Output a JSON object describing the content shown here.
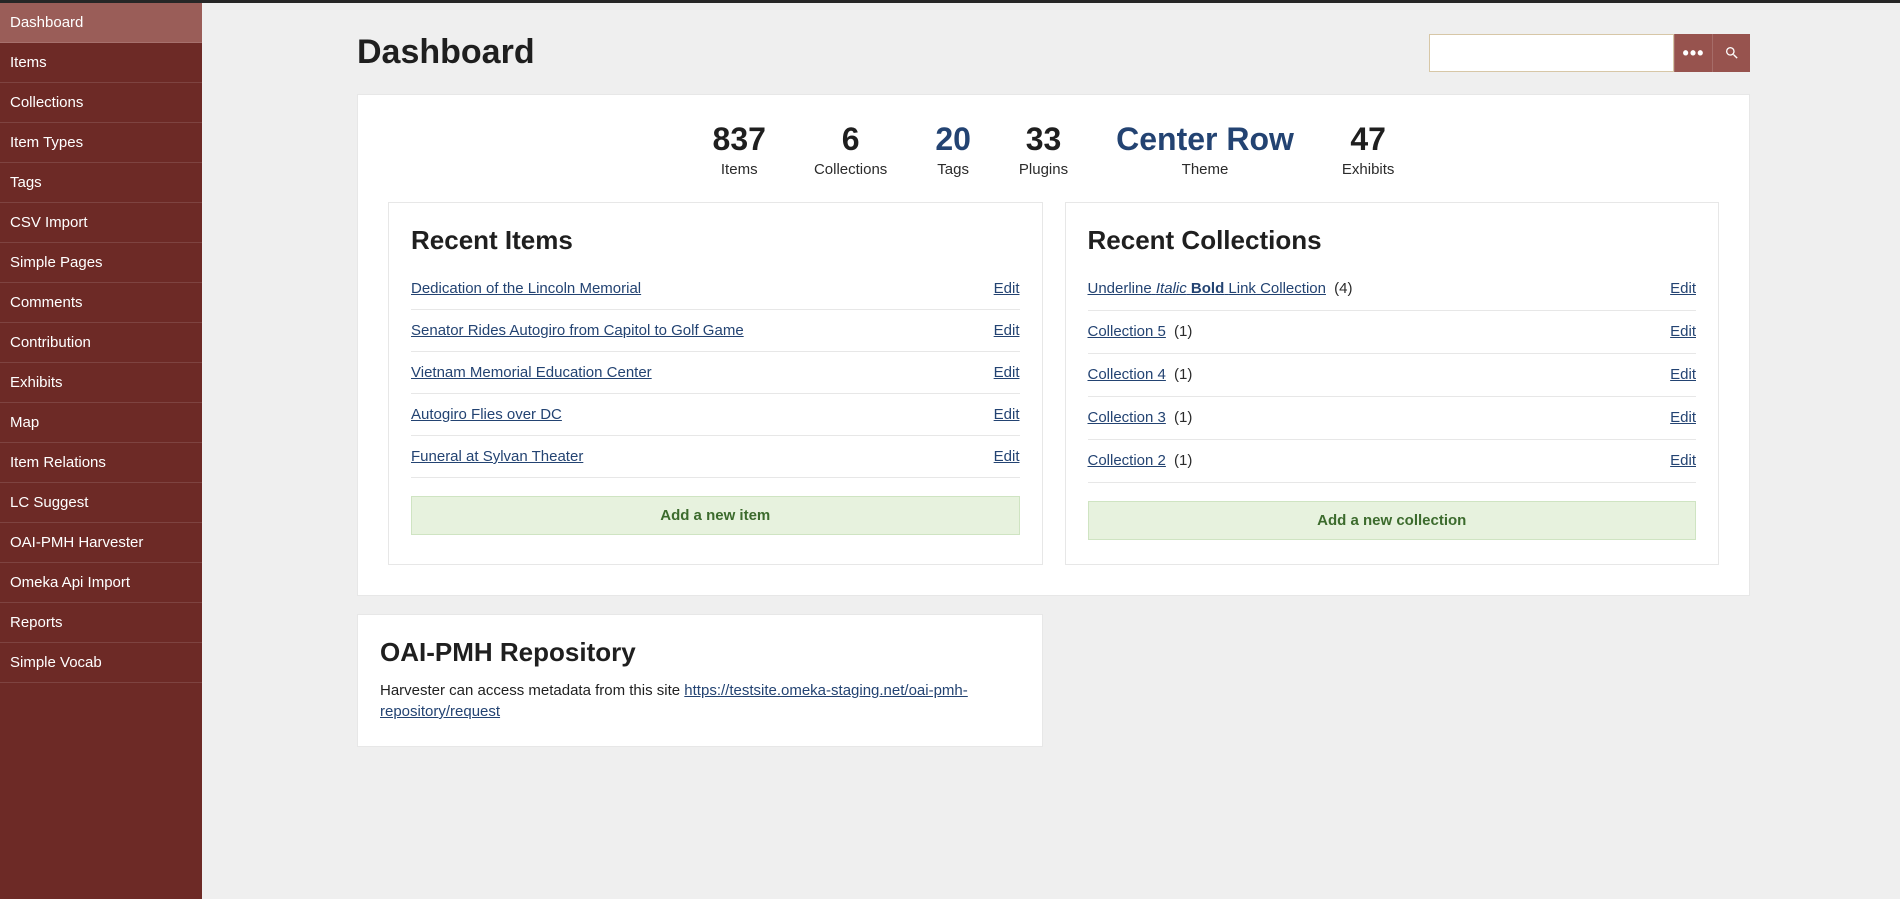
{
  "sidebar": {
    "items": [
      {
        "label": "Dashboard",
        "active": true
      },
      {
        "label": "Items"
      },
      {
        "label": "Collections"
      },
      {
        "label": "Item Types"
      },
      {
        "label": "Tags"
      },
      {
        "label": "CSV Import"
      },
      {
        "label": "Simple Pages"
      },
      {
        "label": "Comments"
      },
      {
        "label": "Contribution"
      },
      {
        "label": "Exhibits"
      },
      {
        "label": "Map"
      },
      {
        "label": "Item Relations"
      },
      {
        "label": "LC Suggest"
      },
      {
        "label": "OAI-PMH Harvester"
      },
      {
        "label": "Omeka Api Import"
      },
      {
        "label": "Reports"
      },
      {
        "label": "Simple Vocab"
      }
    ]
  },
  "header": {
    "title": "Dashboard",
    "search_placeholder": ""
  },
  "stats": {
    "items": {
      "value": "837",
      "label": "Items"
    },
    "collections": {
      "value": "6",
      "label": "Collections"
    },
    "tags": {
      "value": "20",
      "label": "Tags"
    },
    "plugins": {
      "value": "33",
      "label": "Plugins"
    },
    "theme": {
      "value": "Center Row",
      "label": "Theme"
    },
    "exhibits": {
      "value": "47",
      "label": "Exhibits"
    }
  },
  "recent_items": {
    "heading": "Recent Items",
    "edit_label": "Edit",
    "add_label": "Add a new item",
    "rows": [
      {
        "title": "Dedication of the Lincoln Memorial"
      },
      {
        "title": "Senator Rides Autogiro from Capitol to Golf Game"
      },
      {
        "title": "Vietnam Memorial Education Center"
      },
      {
        "title": "Autogiro Flies over DC"
      },
      {
        "title": "Funeral at Sylvan Theater"
      }
    ]
  },
  "recent_collections": {
    "heading": "Recent Collections",
    "edit_label": "Edit",
    "add_label": "Add a new collection",
    "rows": [
      {
        "title_parts": {
          "underline": "Underline",
          "italic": "Italic",
          "bold": "Bold",
          "rest": "Link Collection"
        },
        "count": "(4)"
      },
      {
        "title": "Collection 5",
        "count": "(1)"
      },
      {
        "title": "Collection 4",
        "count": "(1)"
      },
      {
        "title": "Collection 3",
        "count": "(1)"
      },
      {
        "title": "Collection 2",
        "count": "(1)"
      }
    ]
  },
  "oai": {
    "heading": "OAI-PMH Repository",
    "text_prefix": "Harvester can access metadata from this site ",
    "url": "https://testsite.omeka-staging.net/oai-pmh-repository/request"
  }
}
